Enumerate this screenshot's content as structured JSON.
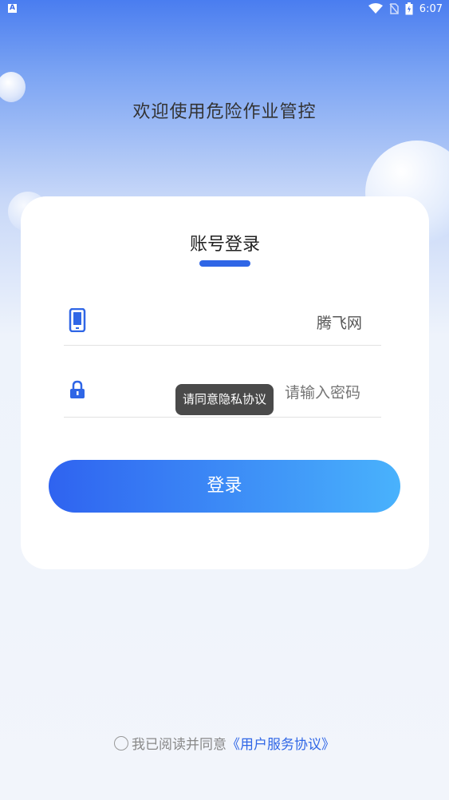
{
  "status_bar": {
    "app_icon": "A",
    "time": "6:07",
    "icons": [
      "wifi-icon",
      "no-sim-icon",
      "battery-icon"
    ]
  },
  "welcome_title": "欢迎使用危险作业管控",
  "login_card": {
    "title": "账号登录",
    "account_value": "腾飞网",
    "password_placeholder": "请输入密码",
    "login_button": "登录"
  },
  "toast": "请同意隐私协议",
  "agreement": {
    "prefix": "我已阅读并同意",
    "link": "《用户服务协议》"
  },
  "colors": {
    "accent": "#2f66e6",
    "button_start": "#2f63f0",
    "button_end": "#49b2fc"
  }
}
